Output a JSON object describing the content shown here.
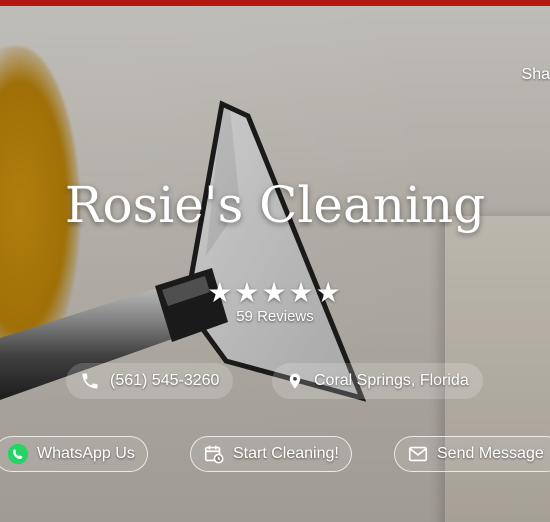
{
  "hero": {
    "title": "Rosie's Cleaning",
    "rating_stars": 5,
    "reviews": "59 Reviews"
  },
  "header": {
    "share_text": "Sha"
  },
  "contact": {
    "phone": "(561) 545-3260",
    "location": "Coral Springs, Florida"
  },
  "actions": {
    "whatsapp": "WhatsApp Us",
    "start": "Start Cleaning!",
    "message": "Send Message"
  },
  "colors": {
    "topbar": "#b3180f",
    "whatsapp": "#25d366"
  },
  "icons": [
    "phone-icon",
    "location-pin-icon",
    "whatsapp-icon",
    "calendar-clock-icon",
    "mail-icon",
    "star-icon"
  ]
}
